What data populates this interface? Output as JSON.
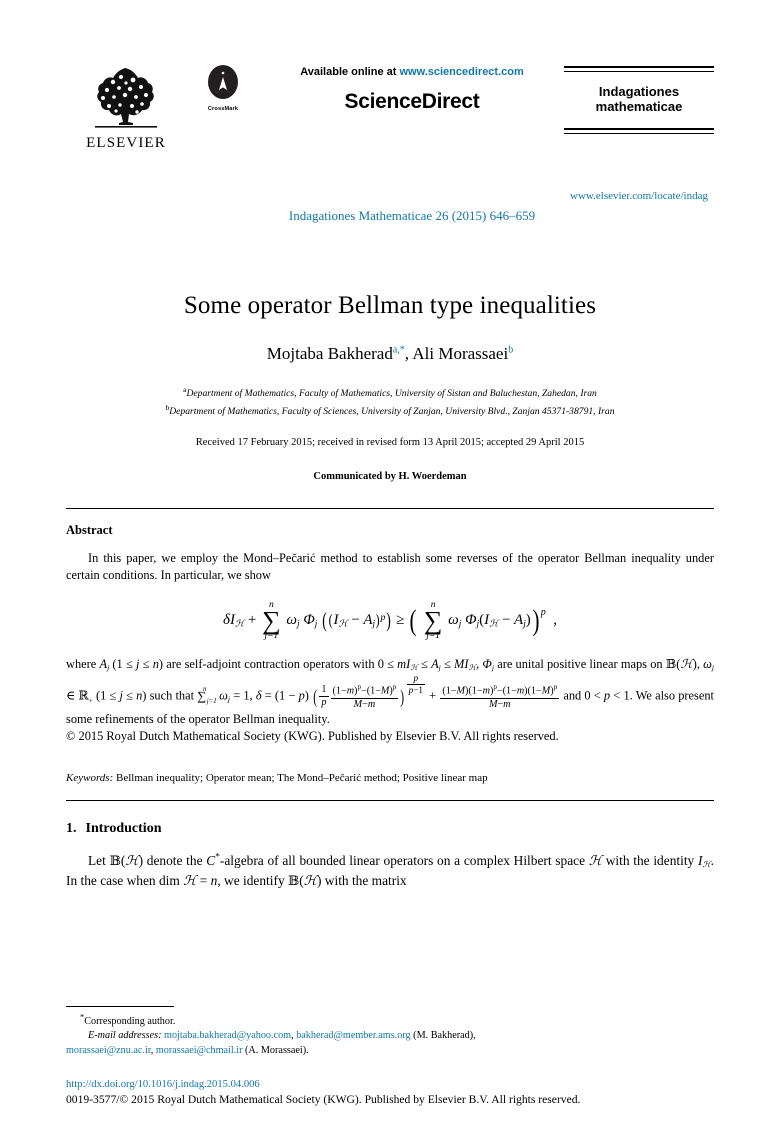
{
  "masthead": {
    "publisher_name": "ELSEVIER",
    "crossmark_label": "CrossMark",
    "available_prefix": "Available online at ",
    "available_url": "www.sciencedirect.com",
    "platform": "ScienceDirect",
    "journal_citation": "Indagationes Mathematicae 26 (2015) 646–659",
    "journal_name_line1": "Indagationes",
    "journal_name_line2": "mathematicae",
    "journal_url": "www.elsevier.com/locate/indag",
    "link_color": "#1277a8"
  },
  "article": {
    "title": "Some operator Bellman type inequalities",
    "authors": [
      {
        "name": "Mojtaba Bakherad",
        "marks": "a,*"
      },
      {
        "name": "Ali Morassaei",
        "marks": "b"
      }
    ],
    "authors_line": "Mojtaba Bakherad",
    "author2": "Ali Morassaei",
    "affiliations": [
      {
        "mark": "a",
        "text": "Department of Mathematics, Faculty of Mathematics, University of Sistan and Baluchestan, Zahedan, Iran"
      },
      {
        "mark": "b",
        "text": "Department of Mathematics, Faculty of Sciences, University of Zanjan, University Blvd., Zanjan 45371-38791, Iran"
      }
    ],
    "history": "Received 17 February 2015; received in revised form 13 April 2015; accepted 29 April 2015",
    "communicated": "Communicated by H. Woerdeman"
  },
  "abstract": {
    "heading": "Abstract",
    "paragraph1": "In this paper, we employ the Mond–Pečarić method to establish some reverses of the operator Bellman inequality under certain conditions. In particular, we show",
    "equation_plain": "δI_ℋ + ∑_{j=1}^{n} ω_j Φ_j((I_ℋ − A_j)^p) ≥ ( ∑_{j=1}^{n} ω_j Φ_j(I_ℋ − A_j) )^p ,",
    "equation_parts": {
      "delta": "δ",
      "identity": "I",
      "hilbert": "ℋ",
      "plus": "+",
      "sigma": "∑",
      "sum_upper": "n",
      "sum_lower": "j=1",
      "omega": "ω",
      "phi": "Φ",
      "sub_j": "j",
      "minus": "−",
      "operator": "A",
      "power": "p",
      "geq": "≥",
      "comma": ","
    },
    "paragraph2_plain": "where A_j (1 ≤ j ≤ n) are self-adjoint contraction operators with 0 ≤ mI_ℋ ≤ A_j ≤ MI_ℋ, Φ_j are unital positive linear maps on 𝔹(ℋ), ω_j ∈ ℝ₊ (1 ≤ j ≤ n) such that ∑_{j=1}^{n} ω_j = 1, δ = (1 − p)( (1/p)((1−m)^p−(1−M)^p)/(M−m) )^{p/(p−1)} + ((1−M)(1−m)^p−(1−m)(1−M)^p)/(M−m) and 0 < p < 1. We also present some refinements of the operator Bellman inequality.",
    "copyright": "© 2015 Royal Dutch Mathematical Society (KWG). Published by Elsevier B.V. All rights reserved."
  },
  "keywords": {
    "label": "Keywords:",
    "text": "Bellman inequality; Operator mean; The Mond–Pečarić method; Positive linear map"
  },
  "introduction": {
    "number": "1.",
    "heading": "Introduction",
    "paragraph_plain": "Let 𝔹(ℋ) denote the C*-algebra of all bounded linear operators on a complex Hilbert space ℋ with the identity I_ℋ. In the case when dim ℋ = n, we identify 𝔹(ℋ) with the matrix"
  },
  "footnotes": {
    "corresponding": "Corresponding author.",
    "email_label": "E-mail addresses:",
    "emails": [
      {
        "address": "mojtaba.bakherad@yahoo.com",
        "sep": ","
      },
      {
        "address": "bakherad@member.ams.org",
        "sep": ""
      }
    ],
    "author1_paren": "(M. Bakherad),",
    "emails2": [
      {
        "address": "morassaei@znu.ac.ir",
        "sep": ","
      },
      {
        "address": "morassaei@chmail.ir",
        "sep": ""
      }
    ],
    "author2_paren": "(A. Morassaei)."
  },
  "bottom": {
    "doi": "http://dx.doi.org/10.1016/j.indag.2015.04.006",
    "issn_line": "0019-3577/© 2015 Royal Dutch Mathematical Society (KWG). Published by Elsevier B.V. All rights reserved."
  }
}
